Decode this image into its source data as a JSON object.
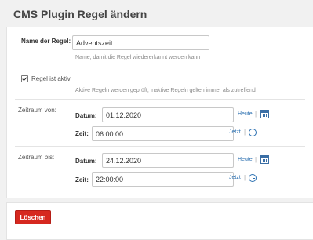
{
  "page": {
    "title": "CMS Plugin Regel ändern"
  },
  "form": {
    "name_label": "Name der Regel:",
    "name_value": "Adventszeit",
    "name_hint": "Name, damit die Regel wiedererkannt werden kann",
    "active_label": "Regel ist aktiv",
    "active_checked": true,
    "active_hint": "Aktive Regeln werden geprüft, inaktive Regeln gelten immer als zutreffend",
    "from": {
      "section_label": "Zeitraum von:",
      "date_label": "Datum:",
      "date_value": "01.12.2020",
      "today_link": "Heute",
      "time_label": "Zeit:",
      "time_value": "06:00:00",
      "now_link": "Jetzt"
    },
    "to": {
      "section_label": "Zeitraum bis:",
      "date_label": "Datum:",
      "date_value": "24.12.2020",
      "today_link": "Heute",
      "time_label": "Zeit:",
      "time_value": "22:00:00",
      "now_link": "Jetzt"
    },
    "separator": "|"
  },
  "footer": {
    "delete_label": "Löschen"
  },
  "colors": {
    "delete_button": "#d6281f",
    "link": "#2a6fb0"
  },
  "icons": {
    "date_picker": "calendar-icon",
    "time_picker": "clock-icon",
    "checkbox": "checkmark-icon"
  }
}
